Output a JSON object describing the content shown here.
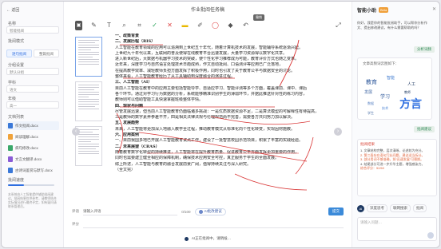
{
  "sidebar": {
    "back": "← 返回",
    "doc_name_label": "名称",
    "doc_name_value": "智能批阅",
    "group1_label": "分组设置",
    "group1_value": "默认分组",
    "mode_label": "批阅模式",
    "mode_options": [
      "逐句批阅",
      "整篇批阅"
    ],
    "field2_label": "学科",
    "field2_value": "语文",
    "field3_label": "年级",
    "field3_value": "高一",
    "field4_label": "评分标准",
    "field4_value": "满分60分",
    "field5_label": "批注方式",
    "field5_value": "手写体",
    "list_label": "文档列表",
    "items": [
      {
        "label": "作文批阅.docx"
      },
      {
        "label": "阅读理解.docx"
      },
      {
        "label": "病句修改.docx"
      },
      {
        "label": "文言文翻译.docx"
      },
      {
        "label": "古诗词鉴赏与默写.docx"
      }
    ],
    "speed_label": "批阅速度",
    "speed_value": 0.35,
    "footer": "本系统由人工智能提供辅助批阅建议，批阅结果仅供参考，请教师结合实际情况进行最终评定，如有疑问请联系管理员。"
  },
  "editor": {
    "title": "作业批阅任务稿",
    "tooltip": "撤销",
    "paragraphs": [
      {
        "text": "一、政策背景",
        "heading": true
      },
      {
        "text": "二、发展历程（RIS）",
        "heading": true
      },
      {
        "text": "人工智能在教育领域的应用可以追溯到上世纪五十年代，随着计算机技术的发展，智能辅导系统逐渐兴起。"
      },
      {
        "text": "上世纪九十年代以来，互联网的普及使得在线教育平台迅速发展，大量学习资源得以数字化共享。"
      },
      {
        "text": "进入新世纪后，大数据与机器学习技术的突破，使个性化学习推荐成为可能，教育评价方式也随之变革。"
      },
      {
        "text": "近年来，深度学习与自然语言处理技术日趋成熟，作文自动批阅、口语测评等应用已广泛落地，"
      },
      {
        "text": "在提高教学效率、减轻教师负担方面发挥了积极作用，同时也引发了关于教育公平与数据安全的讨论。"
      },
      {
        "text": "整体来看，人工智能教育经历了从工具辅助到深度融合的演进过程。"
      },
      {
        "text": "三、人工智能（AI）",
        "heading": true
      },
      {
        "text": "目前人工智能在教育中的应用主要包括智能导学、自适应学习、智能评测等多个方面，覆盖课前、课中、课后"
      },
      {
        "text": "各个环节。通过对学习行为数据的分析，系统能够精准识别学生的薄弱环节，并据此推送针对性的练习内容，"
      },
      {
        "text": "教师则可以借助智能工具快速掌握班级整体学情。"
      },
      {
        "text": "四、现状与问题",
        "heading": true
      },
      {
        "text": "尽管发展迅速，但当前人工智能教育仍面临诸多挑战：一是优质数据资源不足，二是算法模型的可解释性有待提高，"
      },
      {
        "text": "三是教师的数字素养参差不齐，四是相关法律法规与伦理规范尚不完善，需要各方共同努力加以解决。"
      },
      {
        "text": "五、发展趋势",
        "heading": true
      },
      {
        "text": "未来，人工智能将更加深入地融入教学全过程，推动教育模式从标准化向个性化转变，实现因材施教。"
      },
      {
        "text": "六、应用案例",
        "heading": true
      },
      {
        "text": "一、目前我国多地已开展人工智能教育试点工作，建设了一批智慧校园示范项目，积累了丰富的实践经验。"
      },
      {
        "text": "二、未来展望（CRAS）",
        "heading": true
      },
      {
        "text": "随着教育数字化转型的持续推进，人工智能将在提升教育质量、促进教育公平方面发挥更加重要的作用，"
      },
      {
        "text": "同时也需要建立健全相应的保障机制，确保技术应用安全可控，真正服务于学生的全面发展。"
      },
      {
        "text": "综上所述，人工智能与教育的融合发展前景广阔，值得持续关注与深入研究。"
      },
      {
        "text": "（全文完）"
      }
    ],
    "comment_label": "评语",
    "comment_placeholder": "请输入评语",
    "char_count": "0/100",
    "chip_label": "AI批改建议",
    "send_label": "提交",
    "score_label": "评分",
    "status": "AI正在批阅中，请稍候…"
  },
  "chat": {
    "title": "智能小助",
    "tag": "Beta",
    "greeting": "你好，我是你的智能批阅助手，可以帮你分析作文、提出修改建议，有什么需要帮助的吗？",
    "user_msg1": "分析词频",
    "wordcloud_title": "文章高频词云图如下：",
    "words": [
      "教育",
      "智能",
      "人工",
      "发展",
      "学习",
      "数据",
      "技术",
      "方言",
      "教师",
      "学生"
    ],
    "user_msg2": "批阅建议",
    "result_title": "批阅结果",
    "result_lines": [
      "1. 文章结构完整，层次清晰，论述较为充分。",
      "2. 第二段存在语句冗长问题，建议适当拆分。",
      "3. 部分用词不够准确，如“迅速发展”可替换。",
      "4. 结尾部分可进一步升华主题，增强感染力。",
      "综合评分：52/60"
    ],
    "tools": [
      "AI",
      "深度思考",
      "联网搜索",
      "批阅"
    ],
    "input_placeholder": "请输入问题…"
  }
}
